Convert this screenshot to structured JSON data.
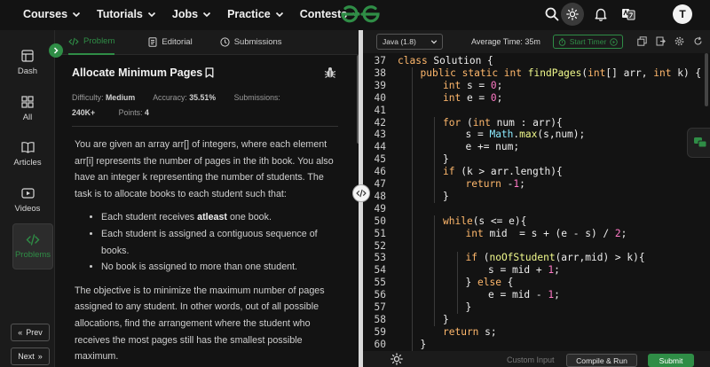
{
  "nav": {
    "menu": [
      "Courses",
      "Tutorials",
      "Jobs",
      "Practice",
      "Contests"
    ]
  },
  "user": {
    "avatar_initial": "T"
  },
  "sidebar": {
    "items": [
      {
        "label": "Dash",
        "icon": "dashboard-icon"
      },
      {
        "label": "All",
        "icon": "grid-icon"
      },
      {
        "label": "Articles",
        "icon": "book-icon"
      },
      {
        "label": "Videos",
        "icon": "video-icon"
      },
      {
        "label": "Problems",
        "icon": "code-icon",
        "active": true
      }
    ],
    "prev_label": "Prev",
    "next_label": "Next"
  },
  "problem_tabs": [
    {
      "label": "Problem",
      "active": true
    },
    {
      "label": "Editorial"
    },
    {
      "label": "Submissions"
    }
  ],
  "problem": {
    "title": "Allocate Minimum Pages",
    "difficulty_label": "Difficulty:",
    "difficulty": "Medium",
    "accuracy_label": "Accuracy:",
    "accuracy": "35.51%",
    "submissions_label": "Submissions:",
    "submissions": "240K+",
    "points_label": "Points:",
    "points": "4",
    "para1": "You are given an array arr[] of integers, where each element arr[i] represents the number of pages in the ith book. You also have an integer k representing the number of students. The task is to allocate books to each student such that:",
    "bullet1_pre": "Each student receives ",
    "bullet1_bold": "atleast",
    "bullet1_post": " one book.",
    "bullet2": "Each student is assigned a contiguous sequence of books.",
    "bullet3": "No book is assigned to more than one student.",
    "para2": "The objective is to minimize the maximum number of pages assigned to any student. In other words, out of all possible allocations, find the arrangement where the student who receives the most pages still has the smallest possible maximum."
  },
  "editor": {
    "language": "Java (1.8)",
    "avg_time": "Average Time: 35m",
    "timer_label": "Start Timer",
    "custom_input_label": "Custom Input",
    "compile_label": "Compile & Run",
    "submit_label": "Submit",
    "lines": [
      {
        "n": "37",
        "indent": 0,
        "tokens": [
          [
            "kw",
            "class"
          ],
          [
            "t",
            " Solution {"
          ]
        ]
      },
      {
        "n": "38",
        "indent": 1,
        "tokens": [
          [
            "kw",
            "public static int"
          ],
          [
            "t",
            " "
          ],
          [
            "fn",
            "findPages"
          ],
          [
            "t",
            "("
          ],
          [
            "kw",
            "int"
          ],
          [
            "t",
            "[] arr, "
          ],
          [
            "kw",
            "int"
          ],
          [
            "t",
            " k) {"
          ]
        ]
      },
      {
        "n": "39",
        "indent": 2,
        "tokens": [
          [
            "kw",
            "int"
          ],
          [
            "t",
            " s = "
          ],
          [
            "num",
            "0"
          ],
          [
            "t",
            ";"
          ]
        ]
      },
      {
        "n": "40",
        "indent": 2,
        "tokens": [
          [
            "kw",
            "int"
          ],
          [
            "t",
            " e = "
          ],
          [
            "num",
            "0"
          ],
          [
            "t",
            ";"
          ]
        ]
      },
      {
        "n": "41",
        "indent": 0,
        "tokens": []
      },
      {
        "n": "42",
        "indent": 2,
        "tokens": [
          [
            "kw",
            "for"
          ],
          [
            "t",
            " ("
          ],
          [
            "kw",
            "int"
          ],
          [
            "t",
            " num : arr){"
          ]
        ]
      },
      {
        "n": "43",
        "indent": 3,
        "tokens": [
          [
            "t",
            "s = "
          ],
          [
            "cls",
            "Math"
          ],
          [
            "t",
            "."
          ],
          [
            "fn",
            "max"
          ],
          [
            "t",
            "(s,num);"
          ]
        ]
      },
      {
        "n": "44",
        "indent": 3,
        "tokens": [
          [
            "t",
            "e += num;"
          ]
        ]
      },
      {
        "n": "45",
        "indent": 2,
        "tokens": [
          [
            "t",
            "}"
          ]
        ]
      },
      {
        "n": "46",
        "indent": 2,
        "tokens": [
          [
            "kw",
            "if"
          ],
          [
            "t",
            " (k > arr.length){"
          ]
        ]
      },
      {
        "n": "47",
        "indent": 3,
        "tokens": [
          [
            "kw",
            "return"
          ],
          [
            "t",
            " -"
          ],
          [
            "num",
            "1"
          ],
          [
            "t",
            ";"
          ]
        ]
      },
      {
        "n": "48",
        "indent": 2,
        "tokens": [
          [
            "t",
            "}"
          ]
        ]
      },
      {
        "n": "49",
        "indent": 0,
        "tokens": []
      },
      {
        "n": "50",
        "indent": 2,
        "tokens": [
          [
            "kw",
            "while"
          ],
          [
            "t",
            "(s <= e){"
          ]
        ]
      },
      {
        "n": "51",
        "indent": 3,
        "tokens": [
          [
            "kw",
            "int"
          ],
          [
            "t",
            " mid  = s + (e - s) / "
          ],
          [
            "num",
            "2"
          ],
          [
            "t",
            ";"
          ]
        ]
      },
      {
        "n": "52",
        "indent": 0,
        "tokens": []
      },
      {
        "n": "53",
        "indent": 3,
        "tokens": [
          [
            "kw",
            "if"
          ],
          [
            "t",
            " ("
          ],
          [
            "fn",
            "noOfStudent"
          ],
          [
            "t",
            "(arr,mid) > k){"
          ]
        ]
      },
      {
        "n": "54",
        "indent": 4,
        "tokens": [
          [
            "t",
            "s = mid + "
          ],
          [
            "num",
            "1"
          ],
          [
            "t",
            ";"
          ]
        ]
      },
      {
        "n": "55",
        "indent": 3,
        "tokens": [
          [
            "t",
            "} "
          ],
          [
            "kw",
            "else"
          ],
          [
            "t",
            " {"
          ]
        ]
      },
      {
        "n": "56",
        "indent": 4,
        "tokens": [
          [
            "t",
            "e = mid - "
          ],
          [
            "num",
            "1"
          ],
          [
            "t",
            ";"
          ]
        ]
      },
      {
        "n": "57",
        "indent": 3,
        "tokens": [
          [
            "t",
            "}"
          ]
        ]
      },
      {
        "n": "58",
        "indent": 2,
        "tokens": [
          [
            "t",
            "}"
          ]
        ]
      },
      {
        "n": "59",
        "indent": 2,
        "tokens": [
          [
            "kw",
            "return"
          ],
          [
            "t",
            " s;"
          ]
        ]
      },
      {
        "n": "60",
        "indent": 1,
        "tokens": [
          [
            "t",
            "}"
          ]
        ]
      }
    ]
  },
  "colors": {
    "accent": "#2f8d46",
    "background": "#131313",
    "panel": "#1b1b1b",
    "keyword": "#ffb86c",
    "number": "#ff79c6",
    "function": "#f1fa8c",
    "class": "#8be9fd"
  }
}
